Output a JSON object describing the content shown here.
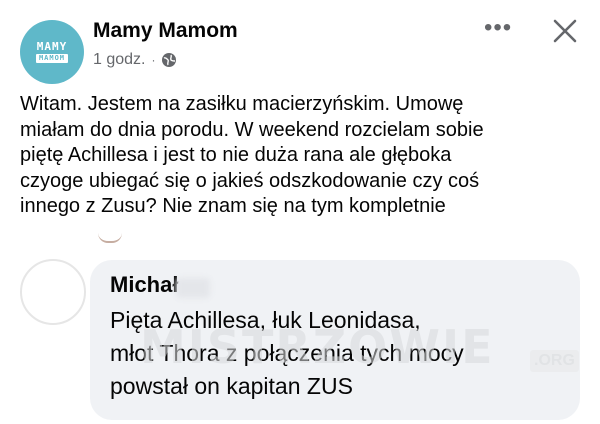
{
  "post": {
    "page_name": "Mamy Mamom",
    "avatar_text_top": "MAMY",
    "avatar_text_bottom": "MAMOM",
    "time": "1 godz.",
    "separator": "·",
    "privacy_icon": "globe-icon",
    "more_icon": "more-horizontal-icon",
    "close_icon": "close-icon",
    "more_label": "•••",
    "text": "Witam. Jestem na zasiłku macierzyńskim. Umowę\nmiałam do dnia porodu.  W weekend rozcielam sobie\npiętę Achillesa i jest to nie duża rana ale głęboka\nczyoge ubiegać się o jakieś odszkodowanie czy coś\ninnego z Zusu? Nie znam się na tym kompletnie"
  },
  "comment": {
    "author": "Michał",
    "text": "Pięta Achillesa, łuk Leonidasa,\nmłot Thora z połączenia tych mocy\npowstał on kapitan ZUS"
  },
  "watermark": {
    "text": "MISTRZOWIE",
    "tld": ".ORG"
  },
  "colors": {
    "avatar": "#5fb8c9",
    "bubble": "#f0f2f5",
    "secondary_text": "#65676b"
  }
}
